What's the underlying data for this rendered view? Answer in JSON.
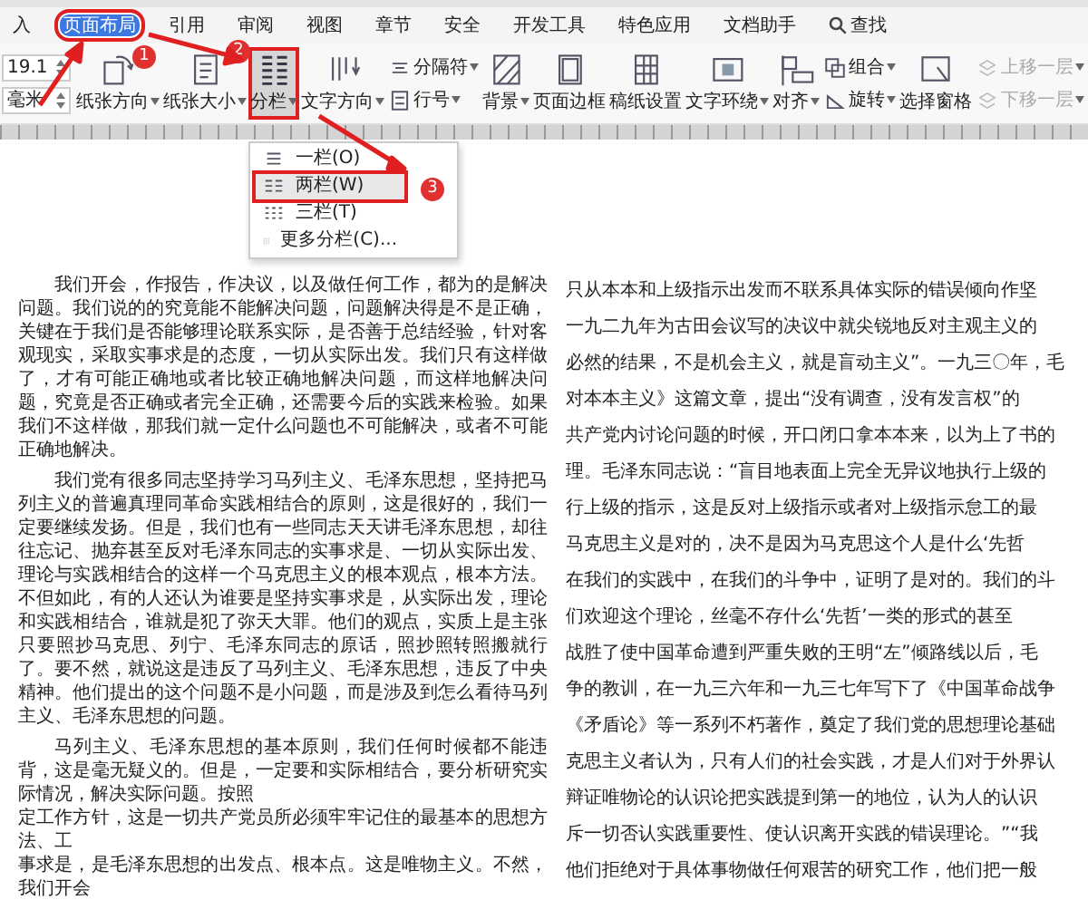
{
  "tabs": [
    {
      "label": "入",
      "selected": false,
      "highlighted": false
    },
    {
      "label": "页面布局",
      "selected": true,
      "highlighted": true,
      "marker": "1"
    },
    {
      "label": "引用",
      "selected": false,
      "highlighted": false
    },
    {
      "label": "审阅",
      "selected": false,
      "highlighted": false
    },
    {
      "label": "视图",
      "selected": false,
      "highlighted": false
    },
    {
      "label": "章节",
      "selected": false,
      "highlighted": false
    },
    {
      "label": "安全",
      "selected": false,
      "highlighted": false
    },
    {
      "label": "开发工具",
      "selected": false,
      "highlighted": false
    },
    {
      "label": "特色应用",
      "selected": false,
      "highlighted": false
    },
    {
      "label": "文档助手",
      "selected": false,
      "highlighted": false
    }
  ],
  "search": {
    "label": "查找"
  },
  "margin_fields": [
    {
      "value": "19.1"
    },
    {
      "value": "毫米"
    }
  ],
  "ribbon": [
    {
      "kind": "large",
      "label": "纸张方向",
      "dropdown": true,
      "highlighted": false
    },
    {
      "kind": "large",
      "label": "纸张大小",
      "dropdown": true,
      "highlighted": false
    },
    {
      "kind": "large",
      "label": "分栏",
      "dropdown": true,
      "highlighted": true,
      "marker": "2",
      "menu": [
        {
          "label": "一栏(O)",
          "selected": false
        },
        {
          "label": "两栏(W)",
          "selected": true,
          "marker": "3"
        },
        {
          "label": "三栏(T)",
          "selected": false
        },
        {
          "label": "更多分栏(C)...",
          "selected": false
        }
      ]
    },
    {
      "kind": "large",
      "label": "文字方向",
      "dropdown": true,
      "highlighted": false
    },
    {
      "kind": "stack",
      "items": [
        {
          "label": "分隔符",
          "dropdown": true,
          "disabled": false
        },
        {
          "label": "行号",
          "dropdown": true,
          "disabled": false
        }
      ]
    },
    {
      "kind": "large",
      "label": "背景",
      "dropdown": true,
      "highlighted": false
    },
    {
      "kind": "large",
      "label": "页面边框",
      "dropdown": false,
      "highlighted": false
    },
    {
      "kind": "large",
      "label": "稿纸设置",
      "dropdown": false,
      "highlighted": false
    },
    {
      "kind": "large",
      "label": "文字环绕",
      "dropdown": true,
      "highlighted": false
    },
    {
      "kind": "large",
      "label": "对齐",
      "dropdown": true,
      "highlighted": false
    },
    {
      "kind": "stack",
      "items": [
        {
          "label": "组合",
          "dropdown": true,
          "disabled": false
        },
        {
          "label": "旋转",
          "dropdown": true,
          "disabled": false
        }
      ]
    },
    {
      "kind": "large",
      "label": "选择窗格",
      "dropdown": false,
      "highlighted": false
    },
    {
      "kind": "stack",
      "items": [
        {
          "label": "上移一层",
          "dropdown": true,
          "disabled": true
        },
        {
          "label": "下移一层",
          "dropdown": true,
          "disabled": true
        }
      ]
    }
  ],
  "left_column": [
    {
      "indent": true,
      "text": "我们开会，作报告，作决议，以及做任何工作，都为的是解决问题。我们说的的究竟能不能解决问题，问题解决得是不是正确，关键在于我们是否能够理论联系实际，是否善于总结经验，针对客观现实，采取实事求是的态度，一切从实际出发。我们只有这样做了，才有可能正确地或者比较正确地解决问题，而这样地解决问题，究竟是否正确或者完全正确，还需要今后的实践来检验。如果我们不这样做，那我们就一定什么问题也不可能解决，或者不可能正确地解决。"
    },
    {
      "indent": true,
      "text": "我们党有很多同志坚持学习马列主义、毛泽东思想，坚持把马列主义的普遍真理同革命实践相结合的原则，这是很好的，我们一定要继续发扬。但是，我们也有一些同志天天讲毛泽东思想，却往往忘记、抛弃甚至反对毛泽东同志的实事求是、一切从实际出发、理论与实践相结合的这样一个马克思主义的根本观点，根本方法。不但如此，有的人还认为谁要是坚持实事求是，从实际出发，理论和实践相结合，谁就是犯了弥天大罪。他们的观点，实质上是主张只要照抄马克思、列宁、毛泽东同志的原话，照抄照转照搬就行了。要不然，就说这是违反了马列主义、毛泽东思想，违反了中央精神。他们提出的这个问题不是小问题，而是涉及到怎么看待马列主义、毛泽东思想的问题。"
    },
    {
      "indent": true,
      "text": "马列主义、毛泽东思想的基本原则，我们任何时候都不能违背，这是毫无疑义的。但是，一定要和实际相结合，要分析研究实际情况，解决实际问题。按照"
    },
    {
      "indent": false,
      "text": "定工作方针，这是一切共产党员所必须牢牢记住的最基本的思想方法、工"
    },
    {
      "indent": false,
      "text": "事求是，是毛泽东思想的出发点、根本点。这是唯物主义。不然，我们开会"
    }
  ],
  "right_column": [
    "只从本本和上级指示出发而不联系具体实际的错误倾向作坚",
    "一九二九年为古田会议写的决议中就尖锐地反对主观主义的",
    "必然的结果，不是机会主义，就是盲动主义”。一九三〇年，毛",
    "对本本主义》这篇文章，提出“没有调查，没有发言权”的",
    "共产党内讨论问题的时候，开口闭口拿本本来，以为上了书的",
    "理。毛泽东同志说：“盲目地表面上完全无异议地执行上级的",
    "行上级的指示，这是反对上级指示或者对上级指示怠工的最",
    "马克思主义是对的，决不是因为马克思这个人是什么‘先哲",
    "在我们的实践中，在我们的斗争中，证明了是对的。我们的斗",
    "们欢迎这个理论，丝毫不存什么‘先哲’一类的形式的甚至",
    "战胜了使中国革命遭到严重失败的王明“左”倾路线以后，毛",
    "争的教训，在一九三六年和一九三七年写下了《中国革命战争",
    "《矛盾论》等一系列不朽著作，奠定了我们党的思想理论基础",
    "克思主义者认为，只有人们的社会实践，才是人们对于外界认",
    "辩证唯物论的认识论把实践提到第一的地位，认为人的认识",
    "斥一切否认实践重要性、使认识离开实践的错误理论。”“我",
    "他们拒绝对于具体事物做任何艰苦的研究工作，他们把一般"
  ]
}
